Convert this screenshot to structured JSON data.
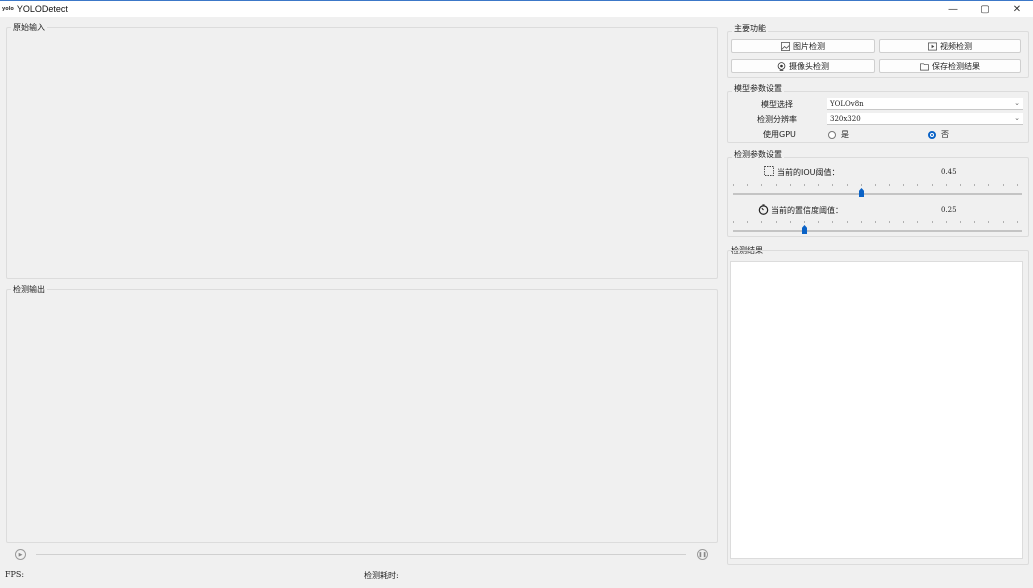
{
  "window": {
    "logo": "yolo",
    "title": "YOLODetect",
    "minimize_glyph": "—",
    "restore_glyph": "▢",
    "close_glyph": "✕"
  },
  "left": {
    "input_title": "原始输入",
    "output_title": "检测输出"
  },
  "main_functions": {
    "title": "主要功能",
    "image_detect": "图片检测",
    "video_detect": "视频检测",
    "camera_detect": "摄像头检测",
    "save_results": "保存检测结果"
  },
  "model_settings": {
    "title": "模型参数设置",
    "model_label": "模型选择",
    "model_value": "YOLOv8n",
    "resolution_label": "检测分辨率",
    "resolution_value": "320x320",
    "gpu_label": "使用GPU",
    "gpu_options": [
      "是",
      "否"
    ],
    "gpu_selected": "否"
  },
  "detect_params": {
    "title": "检测参数设置",
    "iou_label": "当前的IOU阈值：",
    "iou_value": "0.45",
    "conf_label": "当前的置信度阈值：",
    "conf_value": "0.25"
  },
  "results": {
    "title": "检测结果"
  },
  "status_bar": {
    "fps_label": "FPS:",
    "time_label": "检测耗时:"
  },
  "colors": {
    "accent": "#0a62c6",
    "background": "#f0f0f0",
    "border": "#dcdcdc"
  }
}
